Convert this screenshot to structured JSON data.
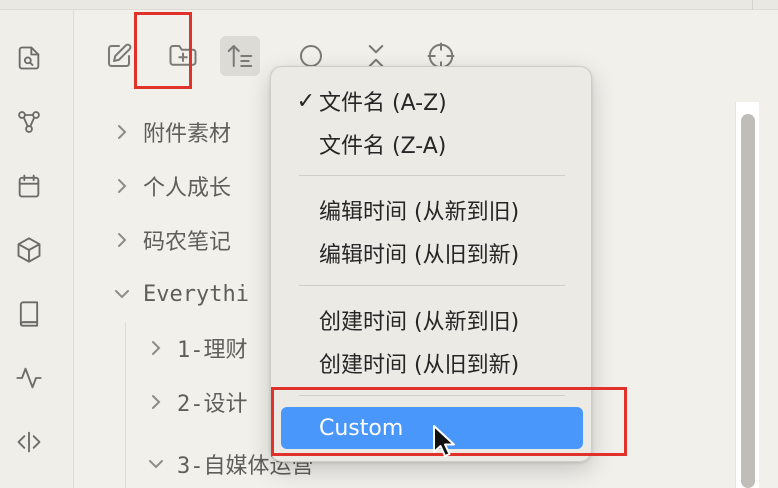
{
  "ribbon": {
    "icons": [
      "search-file-icon",
      "graph-icon",
      "calendar-icon",
      "cube-icon",
      "book-icon",
      "activity-icon",
      "code-icon"
    ]
  },
  "nav": {
    "buttons": [
      "new-note-icon",
      "new-folder-icon",
      "sort-icon",
      "search-icon",
      "collapse-icon",
      "crosshair-icon"
    ]
  },
  "tree": {
    "items": [
      {
        "label": "附件素材",
        "expanded": false
      },
      {
        "label": "个人成长",
        "expanded": false
      },
      {
        "label": "码农笔记",
        "expanded": false
      },
      {
        "label": "Everythi",
        "expanded": true
      },
      {
        "label": "1-理财",
        "expanded": false
      },
      {
        "label": "2-设计",
        "expanded": false
      },
      {
        "label": "3-自媒体运营",
        "expanded": true
      }
    ]
  },
  "sort_menu": {
    "checkmark": "✓",
    "selected": "文件名 (A-Z)",
    "groups": [
      [
        "文件名 (A-Z)",
        "文件名 (Z-A)"
      ],
      [
        "编辑时间 (从新到旧)",
        "编辑时间 (从旧到新)"
      ],
      [
        "创建时间 (从新到旧)",
        "创建时间 (从旧到新)"
      ]
    ],
    "custom_label": "Custom",
    "highlight_color": "#4a97fb"
  },
  "annotations": {
    "highlight_color": "#e0312b"
  }
}
